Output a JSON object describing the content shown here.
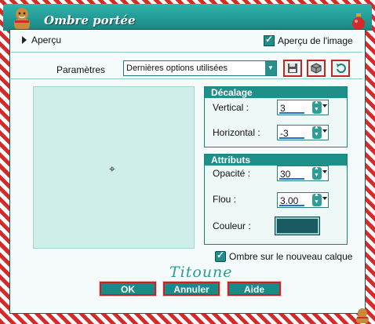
{
  "window": {
    "title": "Ombre portée"
  },
  "apercu": {
    "label": "Aperçu",
    "checkbox_label": "Aperçu de l'image",
    "checked": true
  },
  "parametres": {
    "label": "Paramètres",
    "selected": "Dernières options utilisées",
    "buttons": [
      "save-icon",
      "cube-icon",
      "reset-icon"
    ]
  },
  "decalage": {
    "header": "Décalage",
    "vertical_label": "Vertical :",
    "vertical_value": "3",
    "horizontal_label": "Horizontal :",
    "horizontal_value": "-3"
  },
  "attributs": {
    "header": "Attributs",
    "opacite_label": "Opacité :",
    "opacite_value": "30",
    "flou_label": "Flou :",
    "flou_value": "3.00",
    "couleur_label": "Couleur :",
    "couleur_value": "#1a5a61"
  },
  "calque": {
    "label": "Ombre sur le nouveau calque",
    "checked": true
  },
  "signature": "Titoune",
  "buttons": {
    "ok": "OK",
    "annuler": "Annuler",
    "aide": "Aide"
  },
  "colors": {
    "accent": "#1e8f89",
    "frame_red": "#d42a2a",
    "preview_bg": "#cfeee9"
  }
}
